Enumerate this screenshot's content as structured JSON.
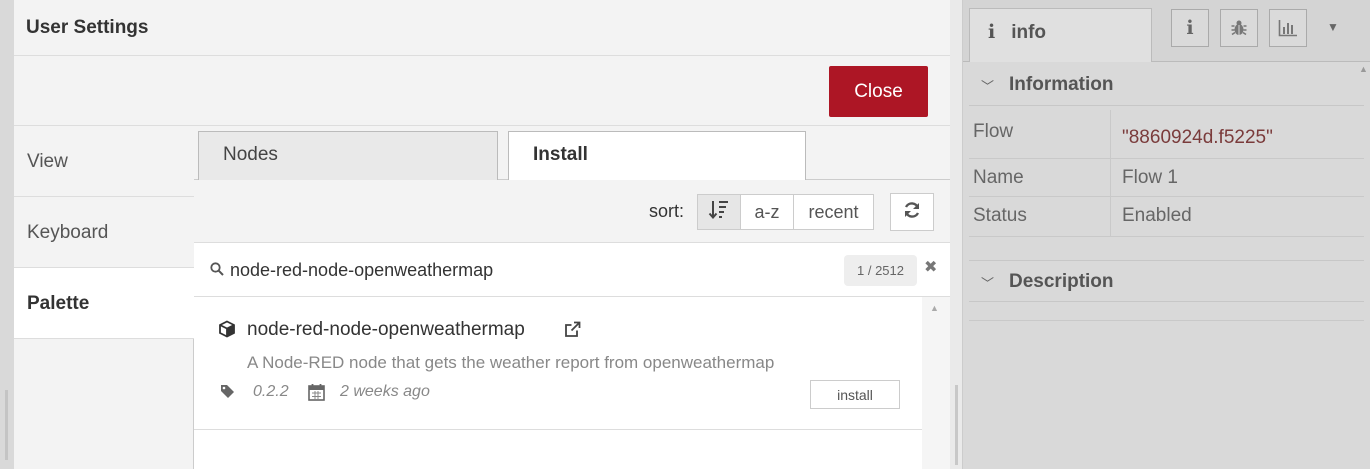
{
  "dialog": {
    "title": "User Settings",
    "close_label": "Close",
    "close_color": "#ad1625"
  },
  "settings_tabs": [
    {
      "label": "View",
      "active": false
    },
    {
      "label": "Keyboard",
      "active": false
    },
    {
      "label": "Palette",
      "active": true
    }
  ],
  "palette": {
    "tabs": [
      {
        "label": "Nodes",
        "active": false
      },
      {
        "label": "Install",
        "active": true
      }
    ],
    "sort": {
      "label": "sort:",
      "options": [
        {
          "label": "",
          "icon": "sort-relevance-icon",
          "active": true
        },
        {
          "label": "a-z",
          "active": false
        },
        {
          "label": "recent",
          "active": false
        }
      ],
      "refresh_icon": "refresh-icon"
    },
    "search": {
      "value": "node-red-node-openweathermap",
      "count": "1 / 2512",
      "clear": "✖"
    },
    "results": [
      {
        "name": "node-red-node-openweathermap",
        "description": "A Node-RED node that gets the weather report from openweathermap",
        "version": "0.2.2",
        "updated": "2 weeks ago",
        "install_label": "install"
      }
    ]
  },
  "sidebar": {
    "tabs": [
      {
        "label": "info",
        "icon": "info-icon"
      }
    ],
    "icon_buttons": [
      "info-icon",
      "bug-icon",
      "bar-chart-icon"
    ],
    "sections": {
      "information": "Information",
      "description": "Description"
    },
    "info_rows": [
      {
        "key": "Flow",
        "value": "\"8860924d.f5225\""
      },
      {
        "key": "Name",
        "value": "Flow 1"
      },
      {
        "key": "Status",
        "value": "Enabled"
      }
    ]
  }
}
